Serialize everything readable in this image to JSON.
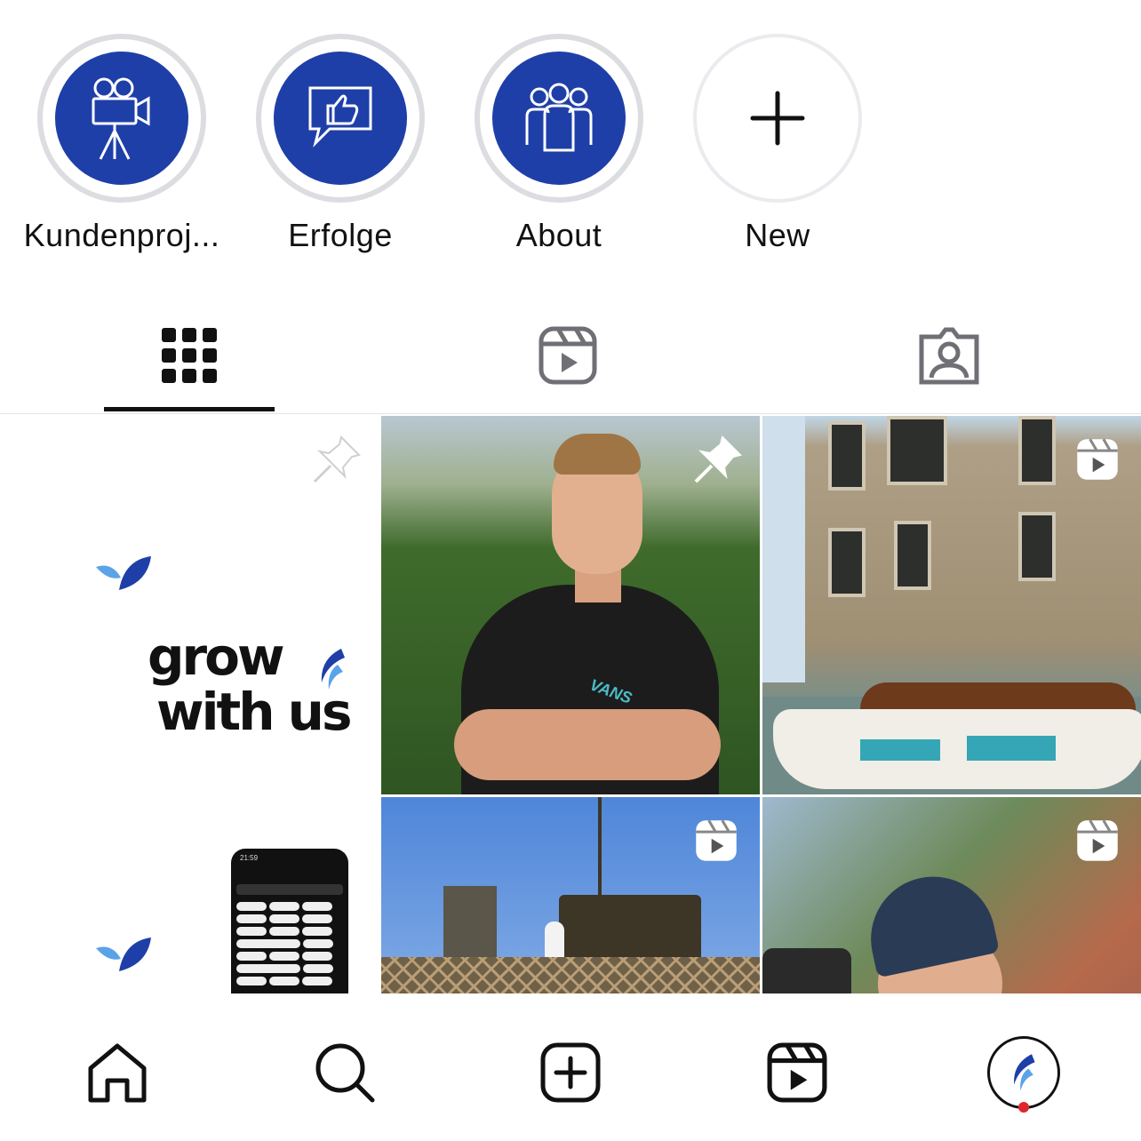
{
  "highlights": [
    {
      "label": "Kundenproj...",
      "icon": "video-camera-icon"
    },
    {
      "label": "Erfolge",
      "icon": "thumbs-up-chat-icon"
    },
    {
      "label": "About",
      "icon": "group-icon"
    },
    {
      "label": "New",
      "icon": "plus-icon"
    }
  ],
  "tabs": [
    {
      "name": "posts",
      "icon": "grid-icon",
      "active": true
    },
    {
      "name": "reels",
      "icon": "reels-icon",
      "active": false
    },
    {
      "name": "tagged",
      "icon": "tagged-user-icon",
      "active": false
    }
  ],
  "grid": {
    "tiles": [
      {
        "kind": "graphic",
        "text_line1": "grow",
        "text_line2": "with us",
        "badge": "pin-icon"
      },
      {
        "kind": "photo",
        "shirt_text": "VANS",
        "badge": "pin-icon"
      },
      {
        "kind": "reel",
        "badge": "reels-icon"
      },
      {
        "kind": "graphic",
        "phone_time": "21:59",
        "badge": ""
      },
      {
        "kind": "reel",
        "badge": "reels-icon"
      },
      {
        "kind": "reel",
        "badge": "reels-icon"
      }
    ]
  },
  "bottom_nav": [
    {
      "name": "home",
      "icon": "home-icon"
    },
    {
      "name": "search",
      "icon": "search-icon"
    },
    {
      "name": "create",
      "icon": "add-post-icon"
    },
    {
      "name": "reels",
      "icon": "reels-icon"
    },
    {
      "name": "profile",
      "icon": "profile-avatar",
      "notification": true
    }
  ],
  "colors": {
    "highlight_fill": "#1f3fa8",
    "highlight_ring": "#dcdde1",
    "notification": "#e0242e",
    "brand_leaf": "#3b7dd8"
  }
}
